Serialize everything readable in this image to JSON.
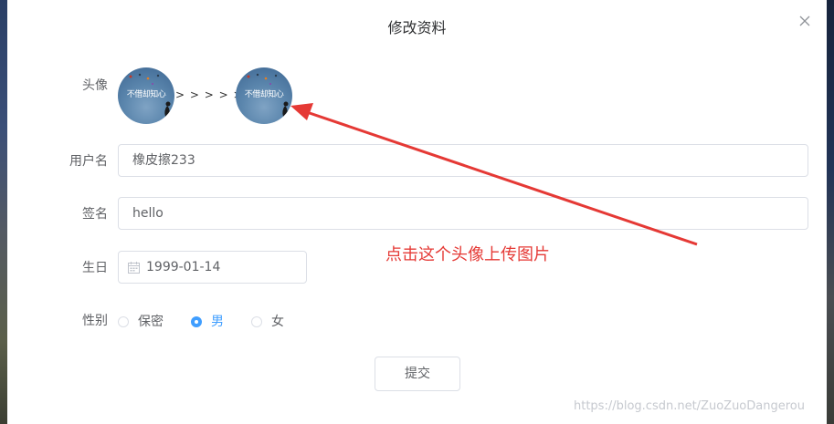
{
  "dialog": {
    "title": "修改资料",
    "close_icon": "close-icon"
  },
  "avatar": {
    "label": "头像",
    "current_image_text": "不借却知心",
    "new_image_text": "不借却知心",
    "separator": "> > > > > >"
  },
  "username": {
    "label": "用户名",
    "value": "橡皮擦233"
  },
  "signature": {
    "label": "签名",
    "value": "hello"
  },
  "birthday": {
    "label": "生日",
    "value": "1999-01-14",
    "icon": "calendar-icon"
  },
  "gender": {
    "label": "性别",
    "options": [
      "保密",
      "男",
      "女"
    ],
    "selected": "男"
  },
  "submit_label": "提交",
  "annotation": {
    "text": "点击这个头像上传图片",
    "color": "#e53935"
  },
  "watermark": "https://blog.csdn.net/ZuoZuoDangerou",
  "colors": {
    "accent": "#409eff",
    "border": "#dcdfe6",
    "text": "#606266"
  }
}
